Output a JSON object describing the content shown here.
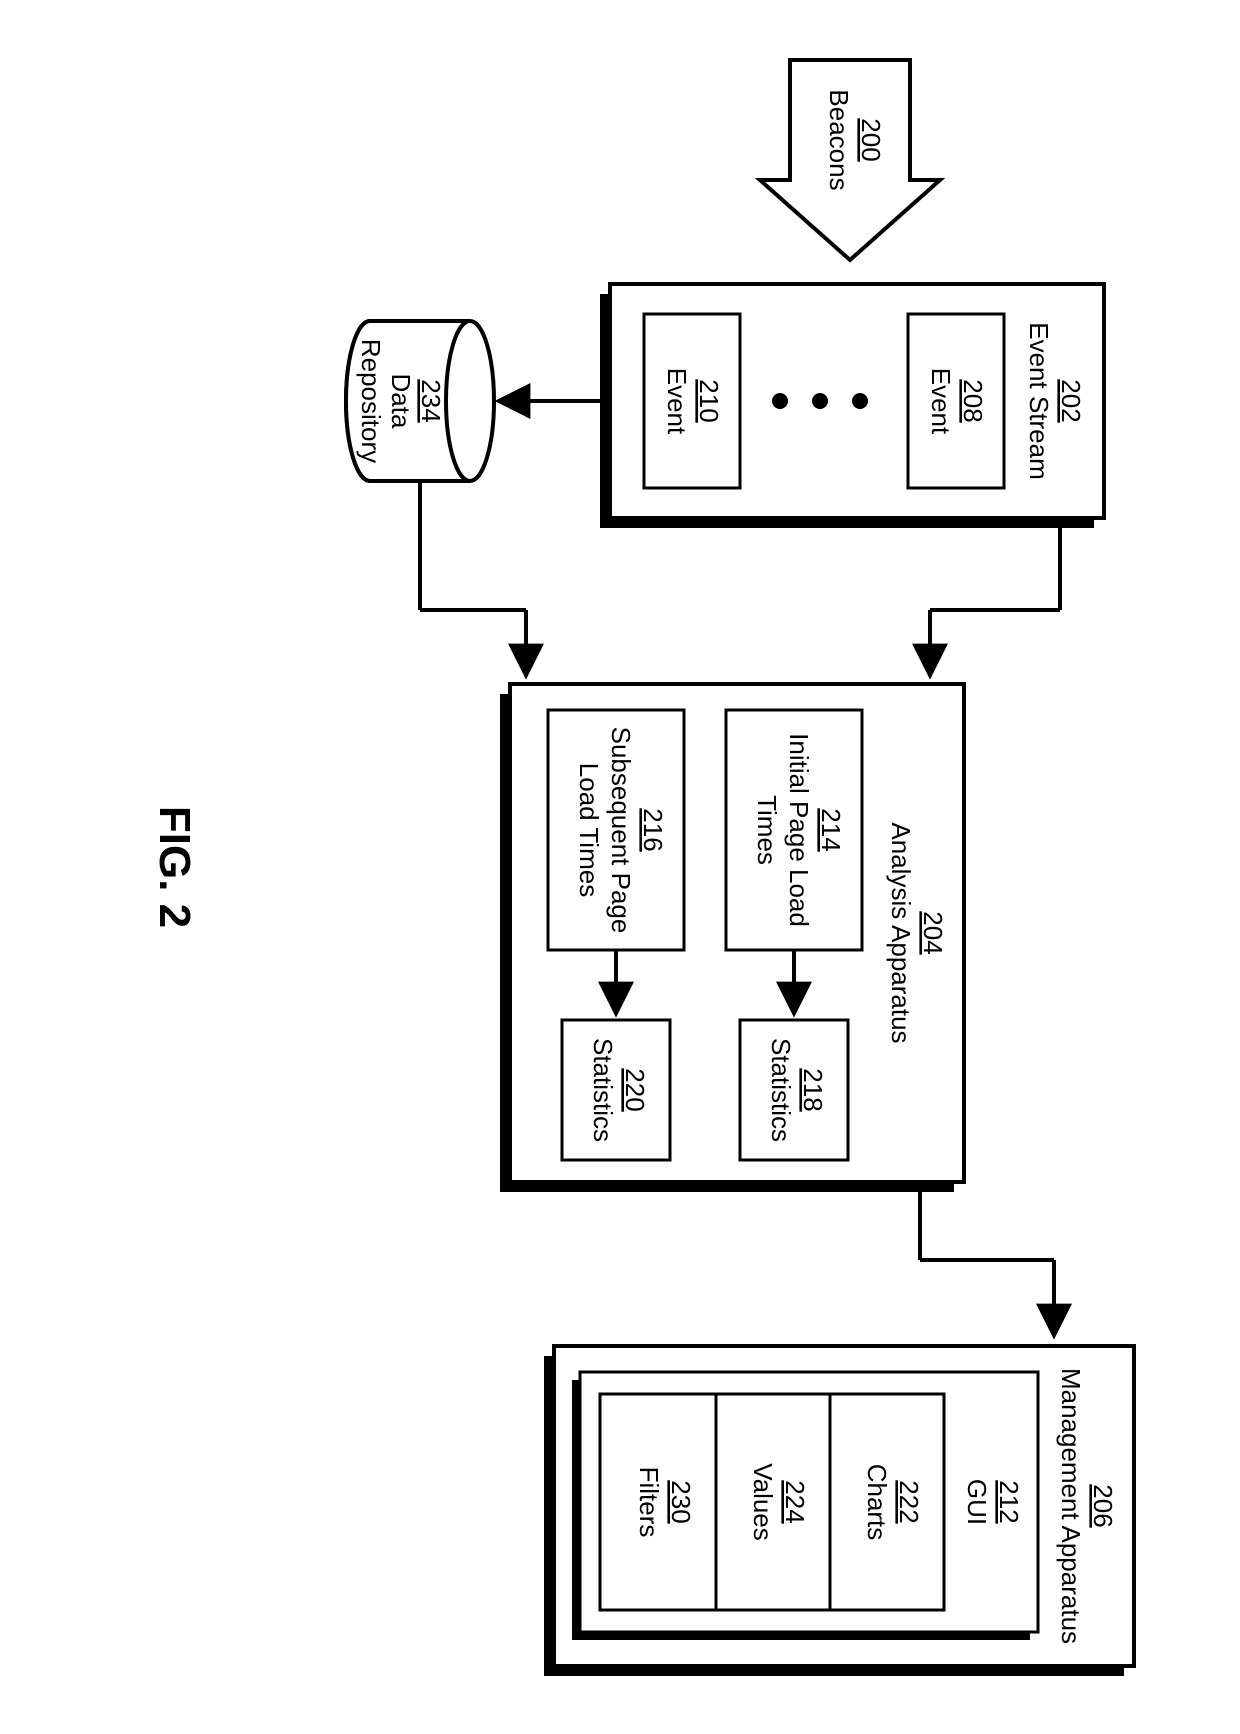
{
  "figure_label": "FIG. 2",
  "beacons": {
    "num": "200",
    "name": "Beacons"
  },
  "event_stream": {
    "num": "202",
    "name": "Event Stream",
    "events": [
      {
        "num": "208",
        "name": "Event"
      },
      {
        "num": "210",
        "name": "Event"
      }
    ]
  },
  "data_repo": {
    "num": "234",
    "name": "Data",
    "name2": "Repository"
  },
  "analysis": {
    "num": "204",
    "name": "Analysis Apparatus",
    "items": [
      {
        "num": "214",
        "name1": "Initial Page Load",
        "name2": "Times"
      },
      {
        "num": "216",
        "name1": "Subsequent Page",
        "name2": "Load Times"
      }
    ],
    "stats": [
      {
        "num": "218",
        "name": "Statistics"
      },
      {
        "num": "220",
        "name": "Statistics"
      }
    ]
  },
  "management": {
    "num": "206",
    "name": "Management Apparatus",
    "gui": {
      "num": "212",
      "name": "GUI"
    },
    "rows": [
      {
        "num": "222",
        "name": "Charts"
      },
      {
        "num": "224",
        "name": "Values"
      },
      {
        "num": "230",
        "name": "Filters"
      }
    ]
  }
}
